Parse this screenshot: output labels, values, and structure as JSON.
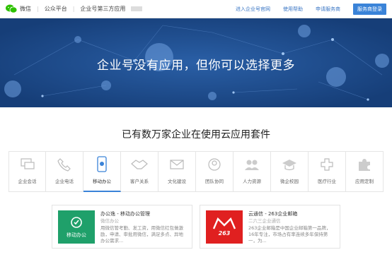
{
  "header": {
    "logo_text": "微信",
    "platform": "公众平台",
    "section": "企业号第三方应用",
    "nav": [
      "进入企业号官网",
      "使用帮助",
      "申请服务商"
    ],
    "login_button": "服务商登录"
  },
  "hero": {
    "title": "企业号没有应用，但你可以选择更多"
  },
  "main": {
    "subtitle": "已有数万家企业在使用云应用套件",
    "categories": [
      {
        "label": "企业会话",
        "icon": "chat-icon"
      },
      {
        "label": "企业电话",
        "icon": "phone-icon"
      },
      {
        "label": "移动办公",
        "icon": "mobile-office-icon"
      },
      {
        "label": "客户关系",
        "icon": "handshake-icon"
      },
      {
        "label": "文化建设",
        "icon": "envelope-icon"
      },
      {
        "label": "团队协同",
        "icon": "team-icon"
      },
      {
        "label": "人力资源",
        "icon": "people-icon"
      },
      {
        "label": "微企校园",
        "icon": "graduation-cap-icon"
      },
      {
        "label": "医疗行业",
        "icon": "medical-cross-icon"
      },
      {
        "label": "应用定制",
        "icon": "puzzle-icon"
      }
    ],
    "active_category": "移动办公",
    "cards": [
      {
        "title": "办公逸 - 移动办公管理",
        "subtitle": "微信办公",
        "description": "用微信管考勤、发工资，用微信红包做激励，申请、审批用微信，满足多点、异地办公需求...",
        "thumb_label": "移动办公",
        "thumb_color": "#1fa06a"
      },
      {
        "title": "云通信 - 263企业邮箱",
        "subtitle": "二六三企业通信",
        "description": "263企业邮箱是中国企业邮箱第一品牌，16年专注，市场占有率连续多年保持第一，为...",
        "thumb_label": "263",
        "thumb_color": "#e02020"
      }
    ]
  },
  "colors": {
    "accent": "#3a83d8",
    "hero_bg": "#1e4d8f"
  }
}
